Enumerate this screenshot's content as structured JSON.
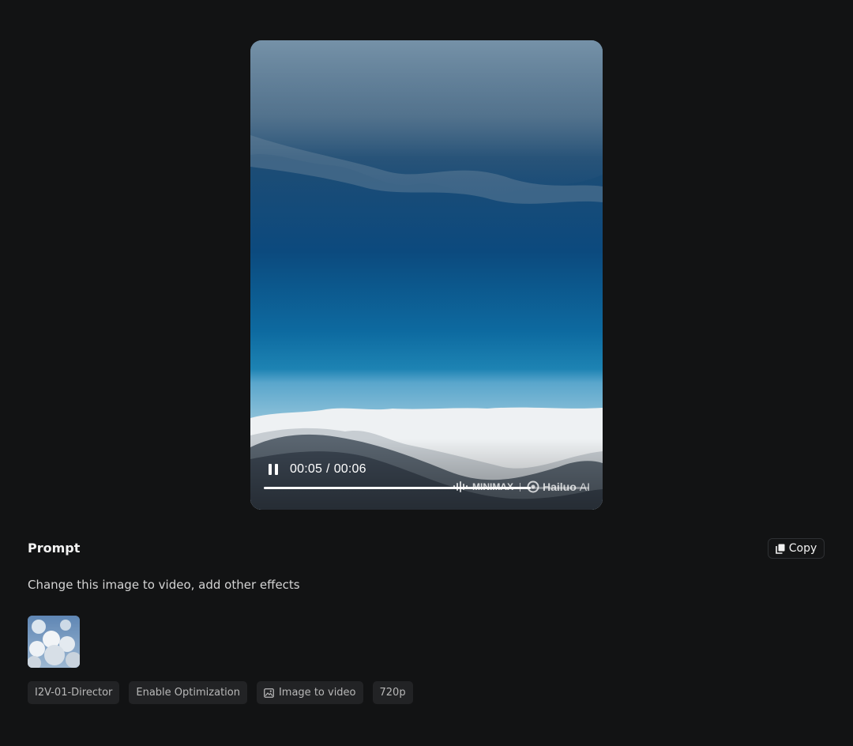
{
  "player": {
    "current_time": "00:05",
    "separator": "/",
    "duration": "00:06",
    "progress": 0.82,
    "watermark": {
      "brand": "MINIMAX",
      "product": "Hailuo",
      "product_suffix": "AI"
    },
    "icon": "pause-icon"
  },
  "prompt": {
    "title": "Prompt",
    "copy_label": "Copy",
    "copy_icon": "copy-icon",
    "text": "Change this image to video, add other effects"
  },
  "tags": [
    {
      "label": "I2V-01-Director"
    },
    {
      "label": "Enable Optimization"
    },
    {
      "label": "Image to video",
      "icon": "image-icon"
    },
    {
      "label": "720p"
    }
  ]
}
